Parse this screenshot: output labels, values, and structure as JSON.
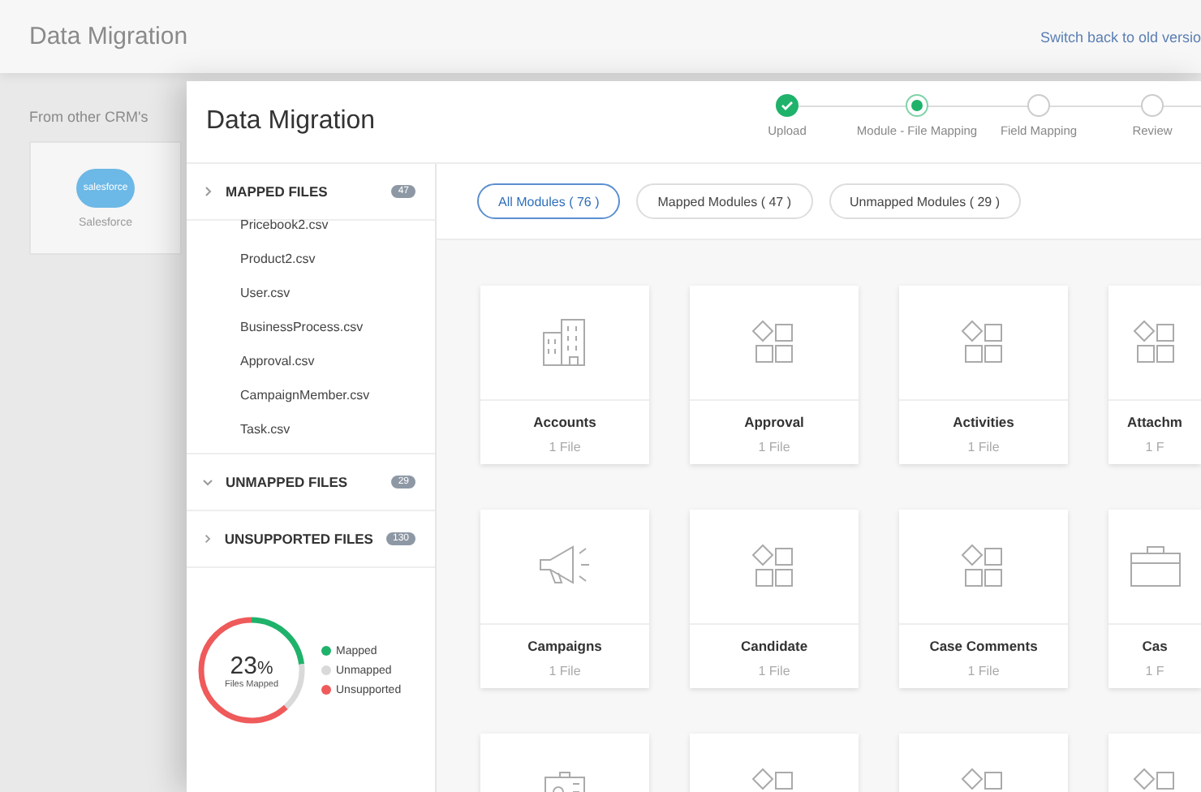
{
  "page": {
    "title": "Data Migration",
    "switch_link": "Switch back to old versio",
    "source_label": "From other CRM's",
    "source_card": {
      "logo_text": "salesforce",
      "name": "Salesforce"
    }
  },
  "dialog": {
    "title": "Data Migration",
    "steps": [
      {
        "label": "Upload",
        "kind": "done"
      },
      {
        "label": "Module - File Mapping",
        "kind": "current"
      },
      {
        "label": "Field Mapping",
        "kind": "pending"
      },
      {
        "label": "Review",
        "kind": "pending"
      }
    ],
    "sections": [
      {
        "title": "MAPPED FILES",
        "count": "47",
        "expanded": false,
        "files": [
          "Pricebook2.csv",
          "Product2.csv",
          "User.csv",
          "BusinessProcess.csv",
          "Approval.csv",
          "CampaignMember.csv",
          "Task.csv"
        ]
      },
      {
        "title": "UNMAPPED FILES",
        "count": "29",
        "expanded": true
      },
      {
        "title": "UNSUPPORTED FILES",
        "count": "130",
        "expanded": false
      }
    ],
    "summary": {
      "percent": "23",
      "unit": "%",
      "caption": "Files Mapped",
      "legend": [
        {
          "label": "Mapped",
          "color": "#1fb26b",
          "level": 0.23
        },
        {
          "label": "Unmapped",
          "color": "#d9d9d9",
          "level": 0.15
        },
        {
          "label": "Unsupported",
          "color": "#ef5a5a",
          "level": 0.62
        }
      ]
    },
    "filters": [
      {
        "label": "All Modules ( 76 )",
        "selected": true
      },
      {
        "label": "Mapped Modules ( 47 )",
        "selected": false
      },
      {
        "label": "Unmapped Modules ( 29 )",
        "selected": false
      }
    ],
    "modules": [
      {
        "kind": "building",
        "name": "Accounts",
        "files": "1 File"
      },
      {
        "kind": "shapes",
        "name": "Approval",
        "files": "1 File"
      },
      {
        "kind": "shapes",
        "name": "Activities",
        "files": "1 File"
      },
      {
        "kind": "shapes",
        "name": "Attachm",
        "files": "1 F"
      },
      {
        "kind": "megaphone",
        "name": "Campaigns",
        "files": "1 File"
      },
      {
        "kind": "shapes",
        "name": "Candidate",
        "files": "1 File"
      },
      {
        "kind": "shapes",
        "name": "Case Comments",
        "files": "1 File"
      },
      {
        "kind": "briefcase",
        "name": "Cas",
        "files": "1 F"
      },
      {
        "kind": "contact"
      },
      {
        "kind": "shapes"
      },
      {
        "kind": "shapes"
      },
      {
        "kind": "shapes"
      }
    ]
  }
}
